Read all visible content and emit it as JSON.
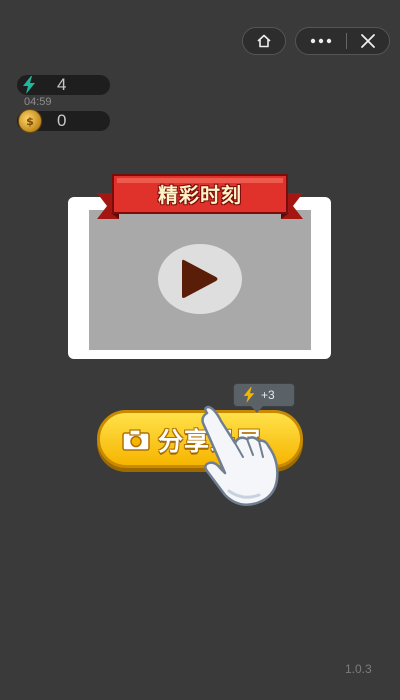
{
  "resources": {
    "energy": "4",
    "energy_timer": "04:59",
    "coins": "0"
  },
  "highlight": {
    "title": "精彩时刻"
  },
  "share": {
    "label": "分享录屏",
    "reward": "+3"
  },
  "version": "1.0.3",
  "icons": {
    "energy": "bolt-icon",
    "coin": "coin-icon",
    "home": "home-icon",
    "more": "more-icon",
    "close": "close-icon",
    "play": "play-icon",
    "camera": "camera-icon",
    "hand": "hand-pointer-icon"
  },
  "colors": {
    "background": "#3a3a3a",
    "ribbon": "#e0322b",
    "button": "#f6c400",
    "energy": "#1fb89a"
  }
}
